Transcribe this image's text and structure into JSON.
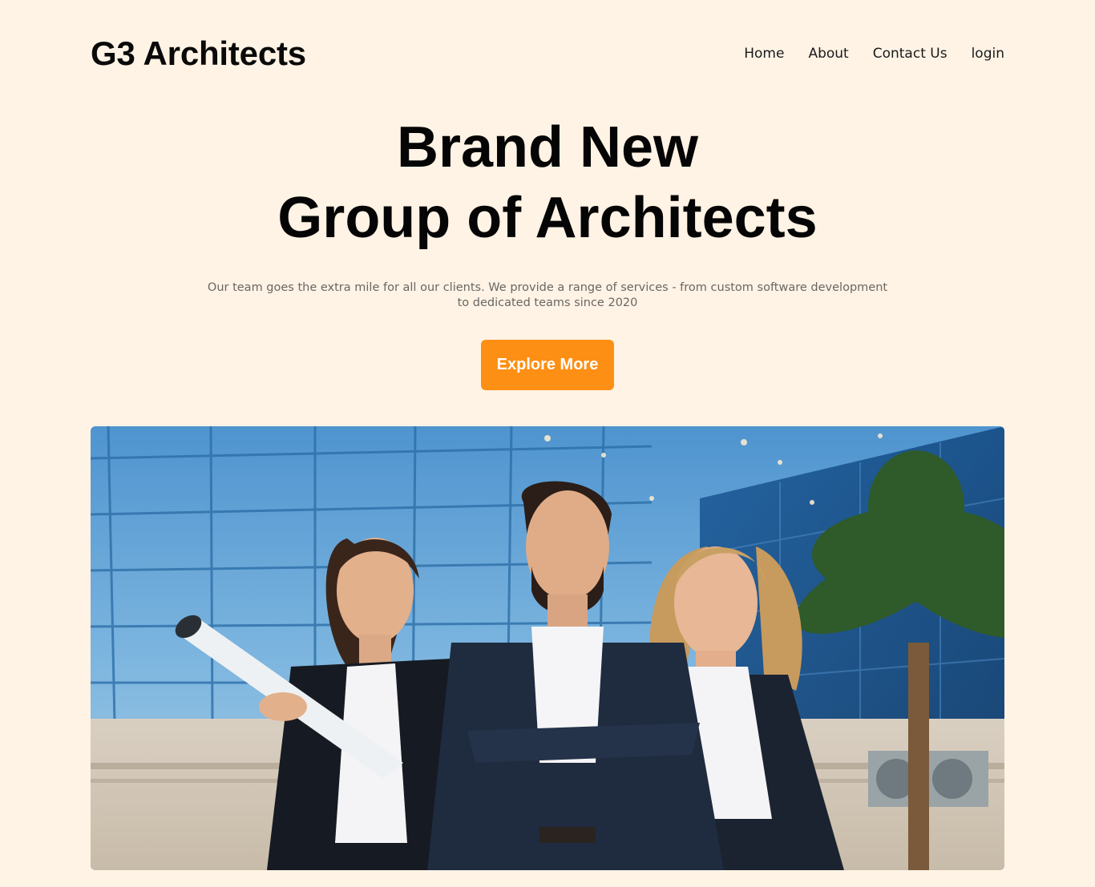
{
  "header": {
    "brand": "G3 Architects",
    "nav": [
      {
        "label": "Home"
      },
      {
        "label": "About"
      },
      {
        "label": "Contact Us"
      },
      {
        "label": "login"
      }
    ]
  },
  "hero": {
    "title_line1": "Brand New",
    "title_line2": "Group of Architects",
    "subtitle": "Our team goes the extra mile for all our clients. We provide a range of services - from custom software development to dedicated teams since 2020",
    "cta_label": "Explore More"
  },
  "colors": {
    "background": "#fff3e5",
    "accent": "#fd8f14"
  }
}
